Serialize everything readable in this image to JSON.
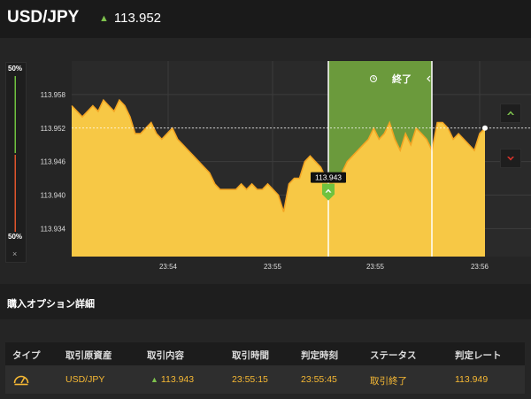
{
  "header": {
    "pair": "USD/JPY",
    "rate": "113.952",
    "rate_direction": "up-arrow-icon"
  },
  "gauge": {
    "top_label": "50%",
    "bottom_label": "50%",
    "close": "×",
    "high_fraction": 0.5,
    "low_fraction": 0.5
  },
  "chart": {
    "expired_label": "終了",
    "entry_marker_label": "113.943",
    "y_ticks": [
      "113.958",
      "113.952",
      "113.946",
      "113.940",
      "113.934"
    ],
    "x_ticks": [
      "23:54",
      "23:55",
      "23:55",
      "23:56"
    ],
    "current_rate": 113.952,
    "colors": {
      "fill": "#f7c845",
      "line": "#f3a523",
      "expired_zone": "#6b9a3c",
      "grid": "#3c3c3c"
    }
  },
  "chart_data": {
    "type": "area",
    "title": "",
    "xlabel": "",
    "ylabel": "",
    "ylim": [
      113.929,
      113.964
    ],
    "x_ticks": [
      "23:54",
      "23:55",
      "23:55",
      "23:56"
    ],
    "y_ticks": [
      113.958,
      113.952,
      113.946,
      113.94,
      113.934
    ],
    "current_rate": 113.952,
    "entry_rate": 113.943,
    "values": [
      113.956,
      113.955,
      113.954,
      113.955,
      113.956,
      113.955,
      113.957,
      113.956,
      113.955,
      113.957,
      113.956,
      113.954,
      113.951,
      113.951,
      113.952,
      113.953,
      113.951,
      113.95,
      113.951,
      113.952,
      113.95,
      113.949,
      113.948,
      113.947,
      113.946,
      113.945,
      113.944,
      113.942,
      113.941,
      113.941,
      113.941,
      113.941,
      113.942,
      113.941,
      113.942,
      113.941,
      113.941,
      113.942,
      113.941,
      113.94,
      113.937,
      113.942,
      113.943,
      113.943,
      113.946,
      113.947,
      113.946,
      113.945,
      113.943,
      113.942,
      113.943,
      113.944,
      113.946,
      113.947,
      113.948,
      113.949,
      113.95,
      113.952,
      113.95,
      113.951,
      113.953,
      113.95,
      113.948,
      113.951,
      113.949,
      113.952,
      113.951,
      113.95,
      113.948,
      113.953,
      113.953,
      113.952,
      113.95,
      113.951,
      113.95,
      113.949,
      113.948,
      113.951,
      113.952
    ]
  },
  "section": {
    "title": "購入オプション詳細"
  },
  "table": {
    "headers": [
      "タイプ",
      "取引原資産",
      "取引内容",
      "取引時間",
      "判定時刻",
      "ステータス",
      "判定レート"
    ],
    "row": {
      "type_icon": "gauge-icon",
      "asset": "USD/JPY",
      "direction_icon": "up-arrow-icon",
      "content": "113.943",
      "trade_time": "23:55:15",
      "judge_time": "23:55:45",
      "status": "取引終了",
      "judge_rate": "113.949"
    }
  }
}
